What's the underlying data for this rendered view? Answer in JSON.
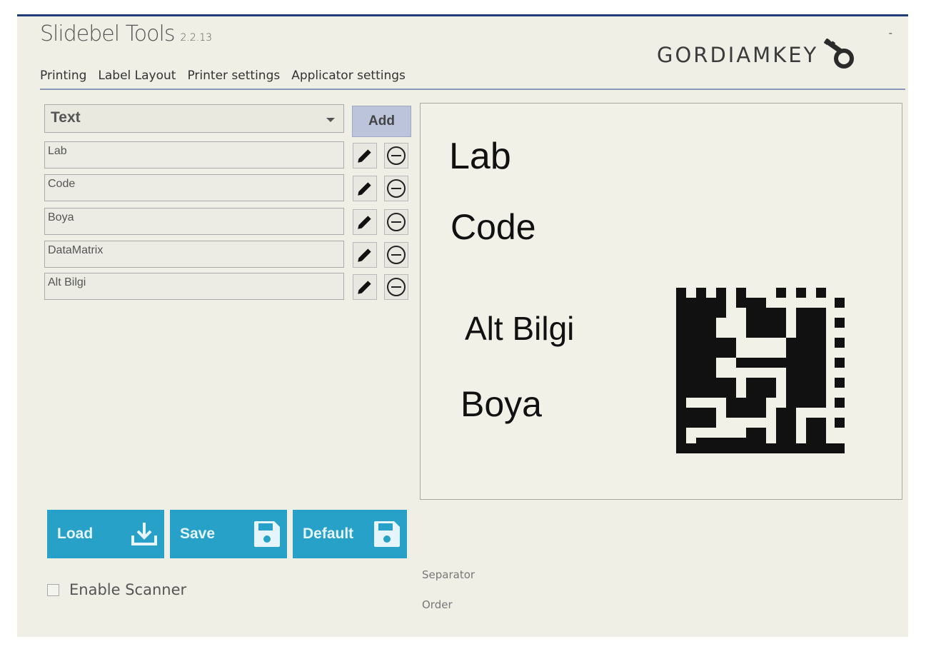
{
  "app": {
    "title": "Slidebel Tools",
    "version": "2.2.13",
    "logo_text": "GORDIAMKEY",
    "minimize": "-"
  },
  "tabs": [
    {
      "label": "Printing"
    },
    {
      "label": "Label Layout",
      "active": true
    },
    {
      "label": "Printer settings"
    },
    {
      "label": "Applicator settings"
    }
  ],
  "element_type": {
    "selected": "Text",
    "add_label": "Add"
  },
  "fields": [
    {
      "value": "Lab"
    },
    {
      "value": "Code"
    },
    {
      "value": "Boya"
    },
    {
      "value": "DataMatrix"
    },
    {
      "value": "Alt Bilgi"
    }
  ],
  "preview": {
    "lab": "Lab",
    "code": "Code",
    "alt_bilgi": "Alt Bilgi",
    "boya": "Boya"
  },
  "buttons": {
    "load": "Load",
    "save": "Save",
    "default": "Default"
  },
  "scanner": {
    "label": "Enable Scanner",
    "checked": false
  },
  "labels": {
    "separator": "Separator",
    "order": "Order"
  },
  "colors": {
    "accent": "#27a1c7",
    "add_button": "#bcc4dc",
    "background": "#efefe6"
  },
  "icons": {
    "edit": "pencil-icon",
    "remove": "minus-circle-icon",
    "load": "download-icon",
    "save": "floppy-disk-icon",
    "logo": "key-icon"
  }
}
